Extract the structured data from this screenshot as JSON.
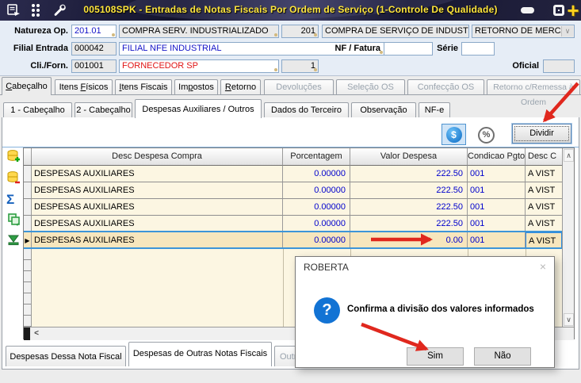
{
  "window": {
    "title": "005108SPK - Entradas de Notas Fiscais Por Ordem de Serviço (1-Controle De Qualidade)"
  },
  "header_form": {
    "natureza_label": "Natureza Op.",
    "natureza_code": "201.01",
    "natureza_desc": "COMPRA SERV. INDUSTRIALIZADO",
    "natureza_code2": "201",
    "natureza_desc2": "COMPRA DE SERVIÇO DE INDUSTRIAL",
    "retorno_combo_value": "RETORNO DE MERCAD",
    "filial_label": "Filial Entrada",
    "filial_code": "000042",
    "filial_desc": "FILIAL NFE INDUSTRIAL",
    "nf_fatura_label": "NF / Fatura",
    "nf_fatura_value": "",
    "serie_label": "Série",
    "serie_value": "",
    "cli_label": "Cli./Forn.",
    "cli_code": "001001",
    "cli_desc": "FORNECEDOR SP",
    "cli_seq": "1",
    "oficial_label": "Oficial",
    "oficial_value": ""
  },
  "main_tabs": [
    {
      "label": "Cabeçalho",
      "accel": 0,
      "state": "active"
    },
    {
      "label": "Itens Físicos",
      "accel": 6,
      "state": "normal"
    },
    {
      "label": "Itens Fiscais",
      "accel": 0,
      "state": "normal"
    },
    {
      "label": "Impostos",
      "accel": 2,
      "state": "normal"
    },
    {
      "label": "Retorno",
      "accel": 0,
      "state": "normal"
    },
    {
      "label": "Devoluções",
      "state": "disabled"
    },
    {
      "label": "Seleção OS",
      "state": "disabled"
    },
    {
      "label": "Confecção OS",
      "state": "disabled"
    },
    {
      "label": "Retorno c/Remessa à Ordem",
      "state": "disabled"
    }
  ],
  "sub_tabs": [
    {
      "label": "1 - Cabeçalho",
      "state": "normal"
    },
    {
      "label": "2 - Cabeçalho",
      "state": "normal"
    },
    {
      "label": "Despesas Auxiliares / Outros",
      "state": "active"
    },
    {
      "label": "Dados do Terceiro",
      "state": "normal"
    },
    {
      "label": "Observação",
      "state": "normal"
    },
    {
      "label": "NF-e",
      "state": "normal"
    }
  ],
  "toolbar": {
    "dividir_label": "Dividir"
  },
  "grid": {
    "columns": {
      "desc": "Desc Despesa Compra",
      "pct": "Porcentagem",
      "valor": "Valor Despesa",
      "cond": "Condicao Pgto",
      "desc_cond": "Desc C"
    },
    "rows": [
      {
        "desc": "DESPESAS AUXILIARES",
        "pct": "0.00000",
        "valor": "222.50",
        "cond": "001",
        "desc_cond": "A VIST"
      },
      {
        "desc": "DESPESAS AUXILIARES",
        "pct": "0.00000",
        "valor": "222.50",
        "cond": "001",
        "desc_cond": "A VIST"
      },
      {
        "desc": "DESPESAS AUXILIARES",
        "pct": "0.00000",
        "valor": "222.50",
        "cond": "001",
        "desc_cond": "A VIST"
      },
      {
        "desc": "DESPESAS AUXILIARES",
        "pct": "0.00000",
        "valor": "222.50",
        "cond": "001",
        "desc_cond": "A VIST"
      },
      {
        "desc": "DESPESAS AUXILIARES",
        "pct": "0.00000",
        "valor": "0.00",
        "cond": "001",
        "desc_cond": "A VIST"
      }
    ],
    "selected_row_index": 4
  },
  "bottom_tabs": [
    {
      "label": "Despesas Dessa Nota Fiscal",
      "state": "normal"
    },
    {
      "label": "Despesas de Outras Notas Fiscais",
      "state": "active"
    },
    {
      "label": "Outr",
      "state": "disabled"
    }
  ],
  "dialog": {
    "title": "ROBERTA",
    "message": "Confirma a divisão dos valores informados",
    "yes_label": "Sim",
    "no_label": "Não"
  },
  "icons": {
    "money": "$",
    "percent": "%",
    "question": "?",
    "close": "×",
    "row_marker": "▶",
    "sum": "Σ",
    "scroll_up": "∧",
    "scroll_down": "∨",
    "scroll_left": "<",
    "minimize": "",
    "maximize": "",
    "window_close_plus": "+"
  },
  "colors": {
    "title_text": "#ffe63a",
    "row_cream": "#fcf6e2",
    "row_selected": "#f7e6bd",
    "selection_border": "#3d95d8",
    "value_blue": "#0000cd",
    "supplier_red": "#e01414",
    "annotation_red": "#e0281e",
    "dialog_icon_blue": "#1273d4"
  }
}
